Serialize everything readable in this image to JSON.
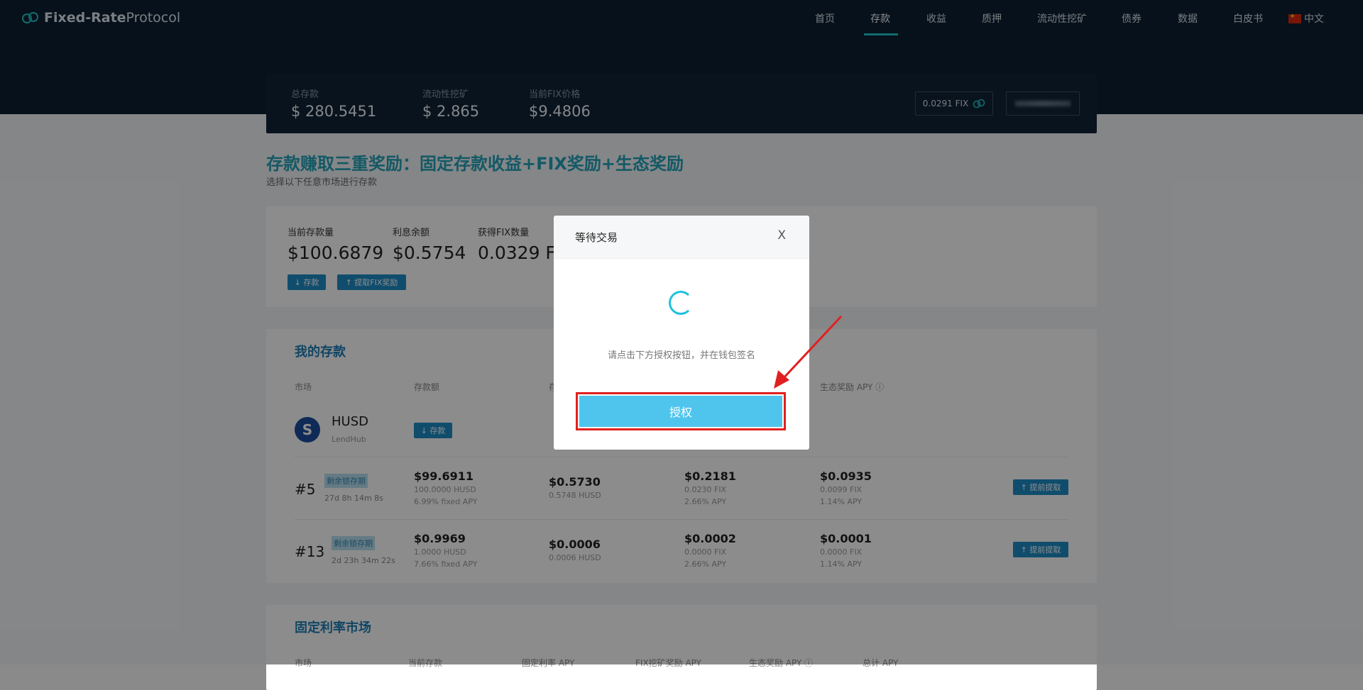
{
  "brand": {
    "name_bold": "Fixed-Rate",
    "name_light": "Protocol",
    "logo_icon": "infinity-cloud-icon"
  },
  "nav": {
    "items": [
      "首页",
      "存款",
      "收益",
      "质押",
      "流动性挖矿",
      "债券",
      "数据",
      "白皮书"
    ],
    "active": "存款",
    "language": "中文"
  },
  "stats": {
    "total_deposit_label": "总存款",
    "total_deposit_value": "$ 280.5451",
    "liquidity_mining_label": "流动性挖矿",
    "liquidity_mining_value": "$ 2.865",
    "fix_price_label": "当前FIX价格",
    "fix_price_value": "$9.4806",
    "fix_balance": "0.0291 FIX"
  },
  "headline": {
    "title": "存款赚取三重奖励：固定存款收益+FIX奖励+生态奖励",
    "subtitle": "选择以下任意市场进行存款"
  },
  "summary": {
    "current_deposit_label": "当前存款量",
    "current_deposit_value": "$100.6879",
    "interest_label": "利息余额",
    "interest_value": "$0.5754",
    "fix_earned_label": "获得FIX数量",
    "fix_earned_value": "0.0329 FIX",
    "deposit_btn": "↓ 存款",
    "claim_btn": "↑ 提取FIX奖励"
  },
  "my_deposits": {
    "title": "我的存款",
    "headers": {
      "market": "市场",
      "amount": "存款额",
      "col3": "存",
      "eco_apy": "生态奖励 APY ⓘ"
    },
    "asset": {
      "name": "HUSD",
      "platform": "LendHub",
      "deposit_btn": "↓ 存款"
    },
    "rows": [
      {
        "id": "#5",
        "tag": "剩余锁存期",
        "countdown": "27d 8h 14m 8s",
        "amount": "$99.6911",
        "amount_sub1": "100.0000 HUSD",
        "amount_sub2": "6.99% fixed APY",
        "interest": "$0.5730",
        "interest_sub": "0.5748 HUSD",
        "fix": "$0.2181",
        "fix_sub1": "0.0230 FIX",
        "fix_sub2": "2.66% APY",
        "eco": "$0.0935",
        "eco_sub1": "0.0099 FIX",
        "eco_sub2": "1.14% APY",
        "action": "↑ 提前提取"
      },
      {
        "id": "#13",
        "tag": "剩余锁存期",
        "countdown": "2d 23h 34m 22s",
        "amount": "$0.9969",
        "amount_sub1": "1.0000 HUSD",
        "amount_sub2": "7.66% fixed APY",
        "interest": "$0.0006",
        "interest_sub": "0.0006 HUSD",
        "fix": "$0.0002",
        "fix_sub1": "0.0000 FIX",
        "fix_sub2": "2.66% APY",
        "eco": "$0.0001",
        "eco_sub1": "0.0000 FIX",
        "eco_sub2": "1.14% APY",
        "action": "↑ 提前提取"
      }
    ]
  },
  "markets": {
    "title": "固定利率市场",
    "headers": [
      "市场",
      "当前存款",
      "固定利率 APY",
      "FIX挖矿奖励 APY",
      "生态奖励 APY ⓘ",
      "总计 APY"
    ]
  },
  "modal": {
    "title": "等待交易",
    "close": "X",
    "message": "请点击下方授权按钮，并在钱包签名",
    "authorize_btn": "授权"
  },
  "colors": {
    "accent": "#1ec8c8",
    "primary_btn": "#4fc5ee",
    "highlight": "#e02020",
    "header_bg": "#0b1f33"
  }
}
